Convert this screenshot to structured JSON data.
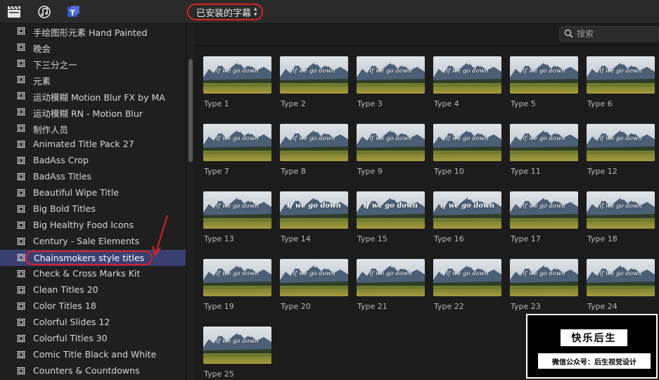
{
  "toolbar": {
    "icons": [
      "clapperboard-icon",
      "music-note-icon",
      "titles-icon"
    ],
    "dropdown_label": "已安装的字幕",
    "dropdown_chevron": "⌃⌄"
  },
  "sidebar": {
    "items": [
      {
        "label": "手绘图形元素 Hand Painted",
        "selected": false
      },
      {
        "label": "晚会",
        "selected": false
      },
      {
        "label": "下三分之一",
        "selected": false
      },
      {
        "label": "元素",
        "selected": false
      },
      {
        "label": "运动模糊 Motion Blur FX by MA",
        "selected": false
      },
      {
        "label": "运动模糊 RN - Motion Blur",
        "selected": false
      },
      {
        "label": "制作人员",
        "selected": false
      },
      {
        "label": "Animated Title Pack 27",
        "selected": false
      },
      {
        "label": "BadAss Crop",
        "selected": false
      },
      {
        "label": "BadAss Titles",
        "selected": false
      },
      {
        "label": "Beautiful Wipe Title",
        "selected": false
      },
      {
        "label": "Big Bold Titles",
        "selected": false
      },
      {
        "label": "Big Healthy Food Icons",
        "selected": false
      },
      {
        "label": "Century - Sale Elements",
        "selected": false
      },
      {
        "label": "Chainsmokers style titles",
        "selected": true
      },
      {
        "label": "Check & Cross Marks Kit",
        "selected": false
      },
      {
        "label": "Clean Titles 20",
        "selected": false
      },
      {
        "label": "Color Titles 18",
        "selected": false
      },
      {
        "label": "Colorful Slides 12",
        "selected": false
      },
      {
        "label": "Colorful Titles 30",
        "selected": false
      },
      {
        "label": "Comic Title Black and White",
        "selected": false
      },
      {
        "label": "Counters & Countdowns",
        "selected": false
      }
    ]
  },
  "search": {
    "placeholder": "搜索",
    "value": ""
  },
  "browser": {
    "thumbnail_caption": "if we go down",
    "tiles": [
      {
        "label": "Type 1"
      },
      {
        "label": "Type 2"
      },
      {
        "label": "Type 3"
      },
      {
        "label": "Type 4"
      },
      {
        "label": "Type 5"
      },
      {
        "label": "Type 6"
      },
      {
        "label": "Type 7"
      },
      {
        "label": "Type 8"
      },
      {
        "label": "Type 9"
      },
      {
        "label": "Type 10"
      },
      {
        "label": "Type 11"
      },
      {
        "label": "Type 12"
      },
      {
        "label": "Type 13"
      },
      {
        "label": "Type 14"
      },
      {
        "label": "Type 15"
      },
      {
        "label": "Type 16"
      },
      {
        "label": "Type 17"
      },
      {
        "label": "Type 18"
      },
      {
        "label": "Type 19"
      },
      {
        "label": "Type 20"
      },
      {
        "label": "Type 21"
      },
      {
        "label": "Type 22"
      },
      {
        "label": "Type 23"
      },
      {
        "label": "Type 24"
      },
      {
        "label": "Type 25"
      }
    ]
  },
  "watermark": {
    "title": "快乐后生",
    "subtitle": "微信公众号：后生视觉设计"
  },
  "colors": {
    "selection": "#3a3f72",
    "highlight_circle": "#e02020",
    "accent_icon": "#3d5bd6"
  }
}
